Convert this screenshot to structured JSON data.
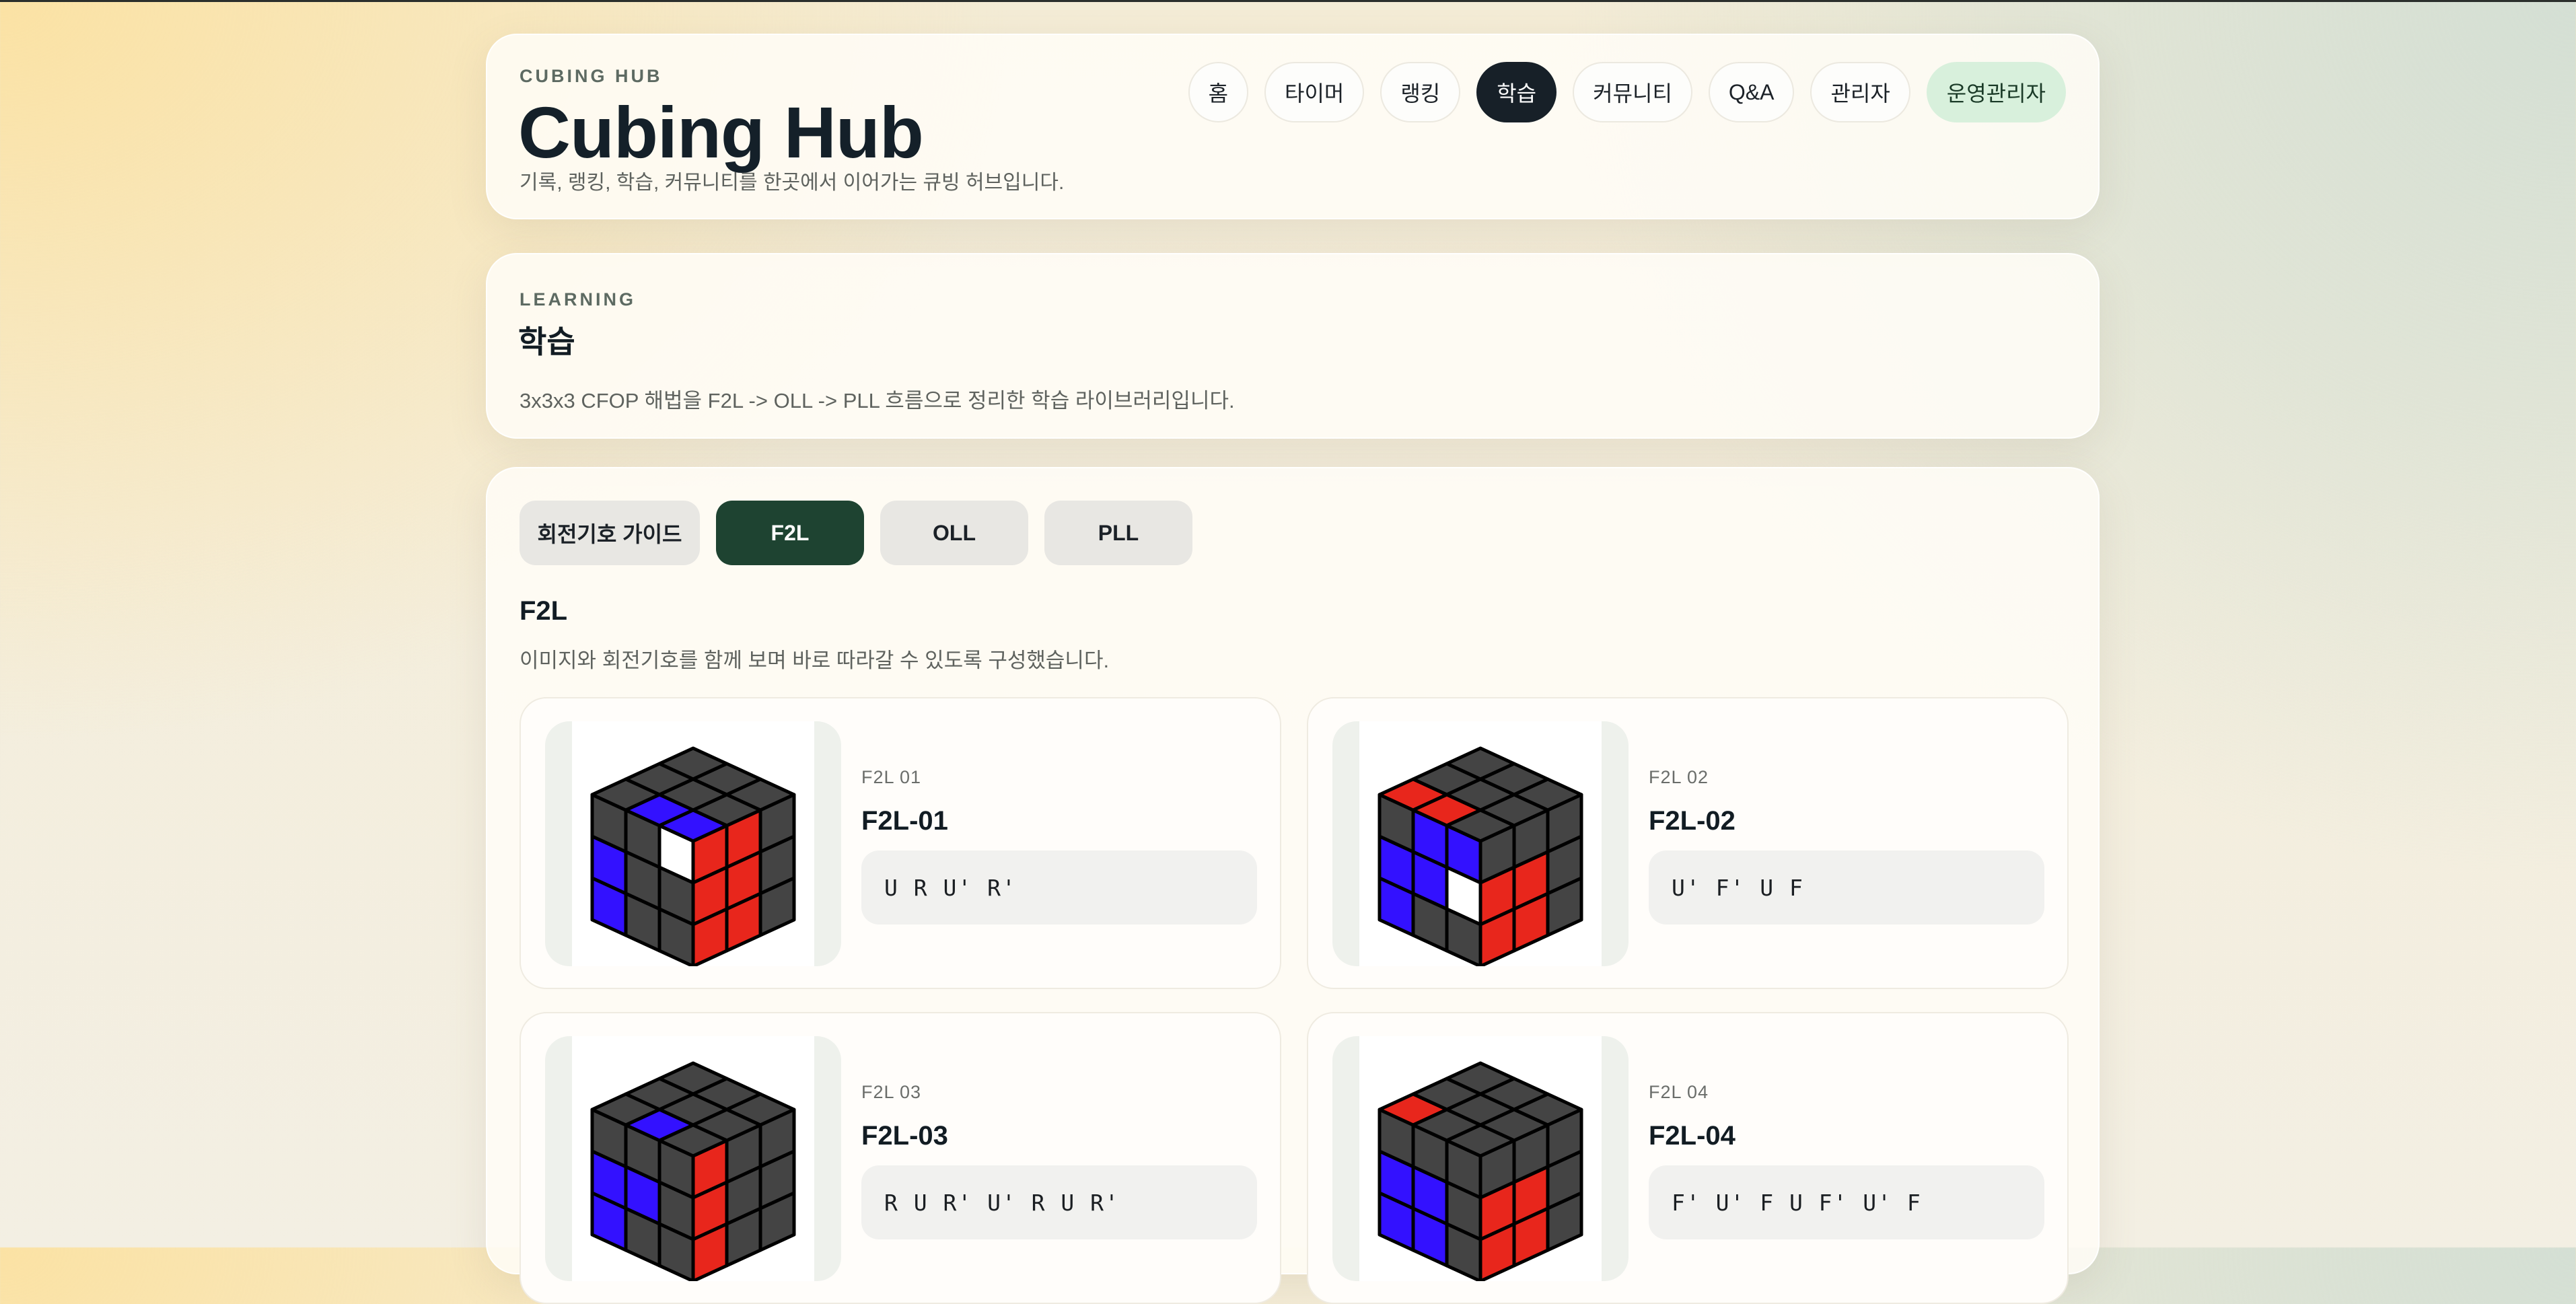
{
  "header": {
    "eyebrow": "CUBING HUB",
    "title": "Cubing Hub",
    "tagline": "기록, 랭킹, 학습, 커뮤니티를 한곳에서 이어가는 큐빙 허브입니다.",
    "nav": [
      "홈",
      "타이머",
      "랭킹",
      "학습",
      "커뮤니티",
      "Q&A",
      "관리자",
      "운영관리자"
    ],
    "active_nav": "학습"
  },
  "learning": {
    "eyebrow": "LEARNING",
    "title": "학습",
    "description": "3x3x3 CFOP 해법을 F2L -> OLL -> PLL 흐름으로 정리한 학습 라이브러리입니다."
  },
  "tabs": {
    "items": [
      "회전기호 가이드",
      "F2L",
      "OLL",
      "PLL"
    ],
    "active": "F2L"
  },
  "section": {
    "title": "F2L",
    "description": "이미지와 회전기호를 함께 보며 바로 따라갈 수 있도록 구성했습니다."
  },
  "cases": [
    {
      "code": "F2L 01",
      "name": "F2L-01",
      "algorithm": "U R U' R'"
    },
    {
      "code": "F2L 02",
      "name": "F2L-02",
      "algorithm": "U' F' U F"
    },
    {
      "code": "F2L 03",
      "name": "F2L-03",
      "algorithm": "R U R' U' R U R'"
    },
    {
      "code": "F2L 04",
      "name": "F2L-04",
      "algorithm": "F' U' F U F' U' F"
    }
  ],
  "colors": {
    "active_nav": "#172028",
    "active_tab": "#1e4331",
    "admin_badge": "#d8f0dc",
    "cube_dark": "#444444",
    "cube_blue": "#3311ff",
    "cube_red": "#e8261c",
    "cube_white": "#ffffff"
  },
  "cube_states": [
    {
      "top": [
        "D",
        "D",
        "D",
        "D",
        "D",
        "D",
        "D",
        "B",
        "B"
      ],
      "left": [
        "D",
        "D",
        "W",
        "B",
        "D",
        "D",
        "B",
        "D",
        "D"
      ],
      "right": [
        "R",
        "R",
        "D",
        "R",
        "R",
        "D",
        "R",
        "R",
        "D"
      ]
    },
    {
      "top": [
        "D",
        "D",
        "D",
        "D",
        "D",
        "D",
        "R",
        "R",
        "D"
      ],
      "left": [
        "D",
        "B",
        "B",
        "B",
        "B",
        "W",
        "B",
        "D",
        "D"
      ],
      "right": [
        "D",
        "D",
        "D",
        "R",
        "R",
        "D",
        "R",
        "R",
        "D"
      ]
    },
    {
      "top": [
        "D",
        "D",
        "D",
        "D",
        "D",
        "D",
        "D",
        "B",
        "D"
      ],
      "left": [
        "D",
        "D",
        "D",
        "B",
        "B",
        "D",
        "B",
        "D",
        "D"
      ],
      "right": [
        "R",
        "D",
        "D",
        "R",
        "D",
        "D",
        "R",
        "D",
        "D"
      ]
    },
    {
      "top": [
        "D",
        "D",
        "D",
        "D",
        "D",
        "D",
        "R",
        "D",
        "D"
      ],
      "left": [
        "D",
        "D",
        "D",
        "B",
        "B",
        "D",
        "B",
        "B",
        "D"
      ],
      "right": [
        "D",
        "D",
        "D",
        "R",
        "R",
        "D",
        "R",
        "R",
        "D"
      ]
    }
  ]
}
